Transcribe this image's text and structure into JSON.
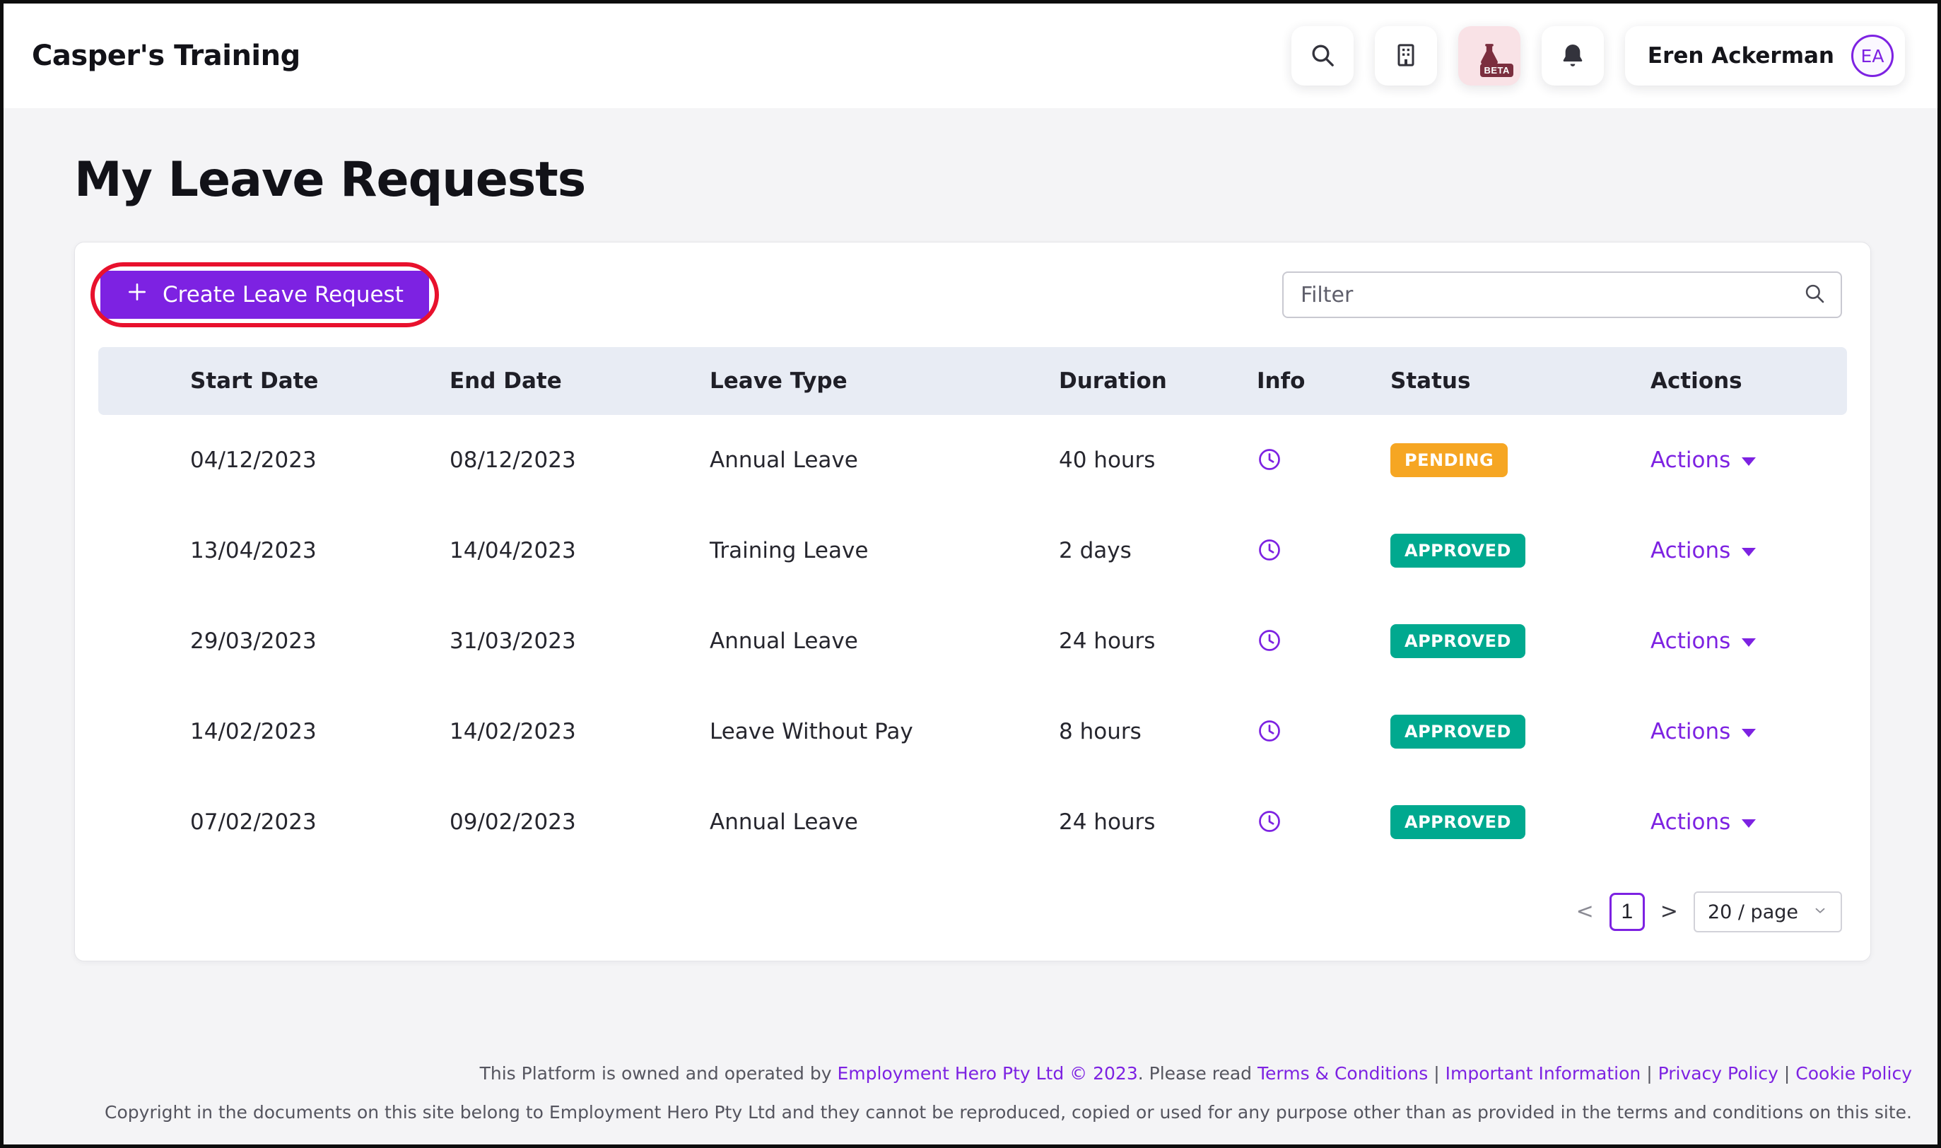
{
  "colors": {
    "accent": "#7d22e2",
    "annotation_red": "#e8112d",
    "pending": "#f6a623",
    "approved": "#00a98f",
    "table_header_bg": "#e8ecf4"
  },
  "header": {
    "brand": "Casper's Training",
    "icons": [
      "search-icon",
      "organisation-icon",
      "beta-flask-icon",
      "notifications-icon"
    ],
    "beta_label": "BETA",
    "user": {
      "name": "Eren Ackerman",
      "initials": "EA"
    }
  },
  "page": {
    "title": "My Leave Requests"
  },
  "toolbar": {
    "create_label": "Create Leave Request",
    "filter_placeholder": "Filter"
  },
  "table": {
    "columns": [
      "Start Date",
      "End Date",
      "Leave Type",
      "Duration",
      "Info",
      "Status",
      "Actions"
    ],
    "actions_label": "Actions",
    "info_icon": "clock-icon",
    "rows": [
      {
        "start_date": "04/12/2023",
        "end_date": "08/12/2023",
        "leave_type": "Annual Leave",
        "duration": "40 hours",
        "status": "PENDING",
        "status_bg": "#f6a623"
      },
      {
        "start_date": "13/04/2023",
        "end_date": "14/04/2023",
        "leave_type": "Training Leave",
        "duration": "2 days",
        "status": "APPROVED",
        "status_bg": "#00a98f"
      },
      {
        "start_date": "29/03/2023",
        "end_date": "31/03/2023",
        "leave_type": "Annual Leave",
        "duration": "24 hours",
        "status": "APPROVED",
        "status_bg": "#00a98f"
      },
      {
        "start_date": "14/02/2023",
        "end_date": "14/02/2023",
        "leave_type": "Leave Without Pay",
        "duration": "8 hours",
        "status": "APPROVED",
        "status_bg": "#00a98f"
      },
      {
        "start_date": "07/02/2023",
        "end_date": "09/02/2023",
        "leave_type": "Annual Leave",
        "duration": "24 hours",
        "status": "APPROVED",
        "status_bg": "#00a98f"
      }
    ]
  },
  "pagination": {
    "prev": "<",
    "page": "1",
    "next": ">",
    "page_size": "20 / page"
  },
  "footer": {
    "line1_segments": [
      {
        "text": "This Platform is owned and operated by ",
        "link": false
      },
      {
        "text": "Employment Hero Pty Ltd © 2023",
        "link": true
      },
      {
        "text": ". Please read ",
        "link": false
      },
      {
        "text": "Terms & Conditions",
        "link": true
      },
      {
        "text": " | ",
        "link": false
      },
      {
        "text": "Important Information",
        "link": true
      },
      {
        "text": " | ",
        "link": false
      },
      {
        "text": "Privacy Policy",
        "link": true
      },
      {
        "text": " | ",
        "link": false
      },
      {
        "text": "Cookie Policy",
        "link": true
      }
    ],
    "line2": "Copyright in the documents on this site belong to Employment Hero Pty Ltd and they cannot be reproduced, copied or used for any purpose other than as provided in the terms and conditions on this site."
  }
}
